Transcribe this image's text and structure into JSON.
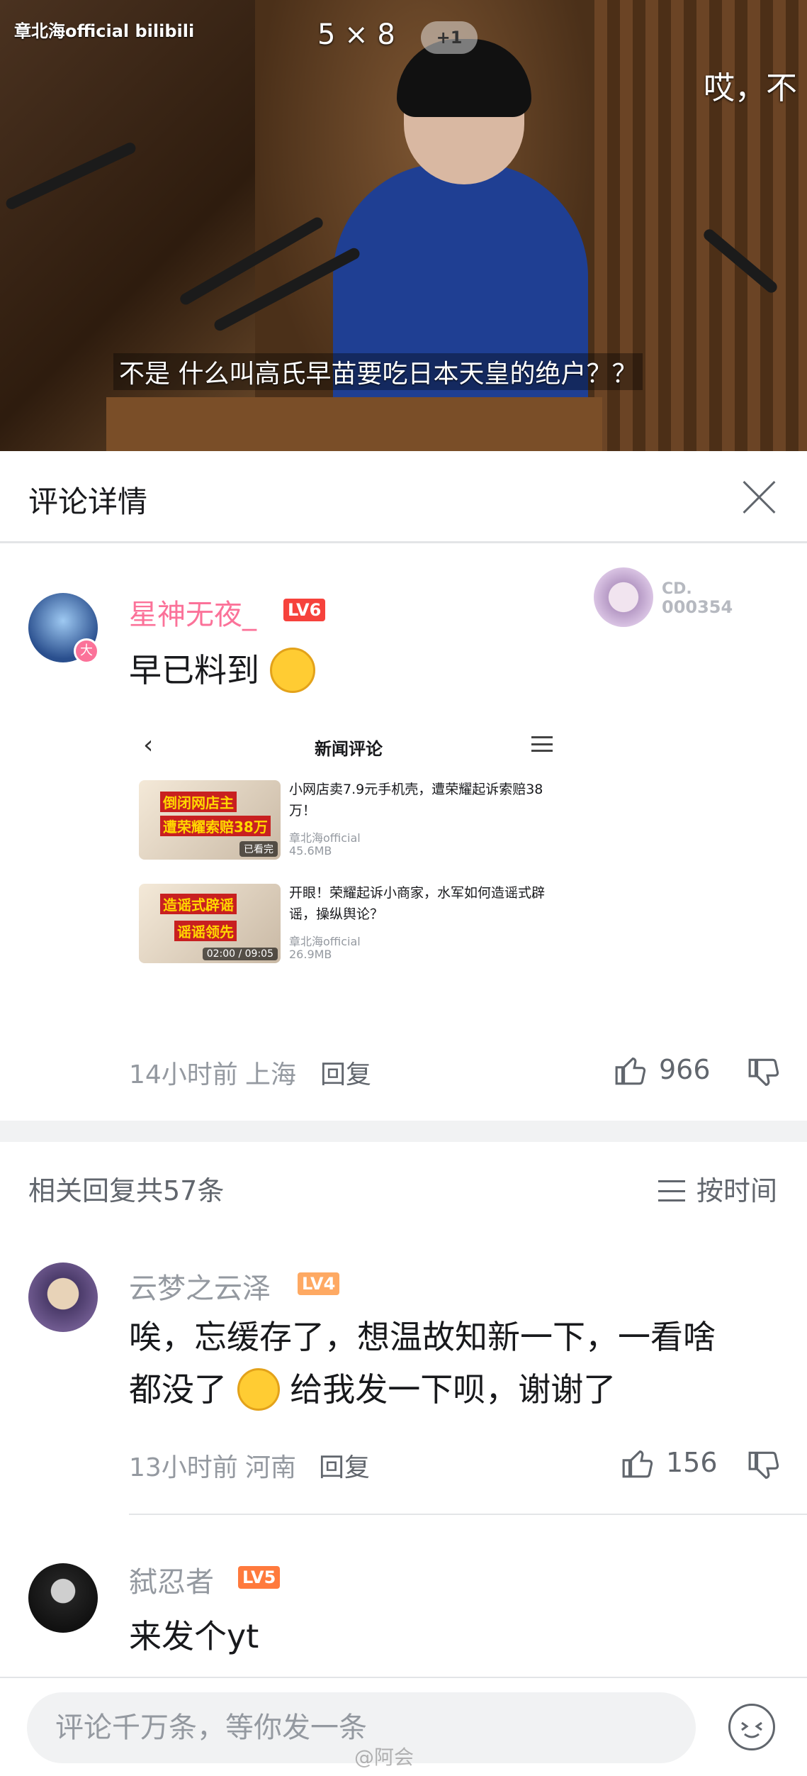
{
  "video": {
    "watermark": "章北海official bilibili",
    "danmaku_count": "5 × 8",
    "danmaku_badge": "+1",
    "danmaku_side": "哎，不",
    "subtitle": "不是 什么叫高氏早苗要吃日本天皇的绝户？？"
  },
  "header": {
    "title": "评论详情"
  },
  "main_comment": {
    "username": "星神无夜_",
    "level": "LV6",
    "avatar_badge": "大",
    "text": "早已料到",
    "fan_badge_top": "CD.",
    "fan_badge_num": "000354",
    "time": "14小时前",
    "location": "上海",
    "reply_label": "回复",
    "likes": "966",
    "screenshot": {
      "title": "新闻评论",
      "items": [
        {
          "thumb_line1": "倒闭网店主",
          "thumb_line2": "遭荣耀索赔38万",
          "thumb_tag": "已看完",
          "title": "小网店卖7.9元手机壳，遭荣耀起诉索赔38万！",
          "uploader": "章北海official",
          "size": "45.6MB"
        },
        {
          "thumb_line1": "造谣式辟谣",
          "thumb_line2": "谣谣领先",
          "thumb_tag": "02:00 / 09:05",
          "title": "开眼！荣耀起诉小商家，水军如何造谣式辟谣，操纵舆论？",
          "uploader": "章北海official",
          "size": "26.9MB"
        }
      ]
    }
  },
  "replies_header": {
    "count": "相关回复共57条",
    "sort": "按时间"
  },
  "replies": [
    {
      "username": "云梦之云泽",
      "level": "LV4",
      "line1": "唉，忘缓存了，想温故知新一下，一看啥",
      "line2a": "都没了",
      "line2b": "给我发一下呗，谢谢了",
      "time": "13小时前",
      "location": "河南",
      "reply_label": "回复",
      "likes": "156"
    },
    {
      "username": "弑忍者",
      "level": "LV5",
      "text": "来发个yt"
    }
  ],
  "bottom": {
    "placeholder": "评论千万条，等你发一条",
    "watermark": "@阿会"
  },
  "colors": {
    "pink_name": "#fb7299",
    "lv6": "#f6423c",
    "lv4": "#fea963",
    "lv5": "#ff7a3d"
  }
}
